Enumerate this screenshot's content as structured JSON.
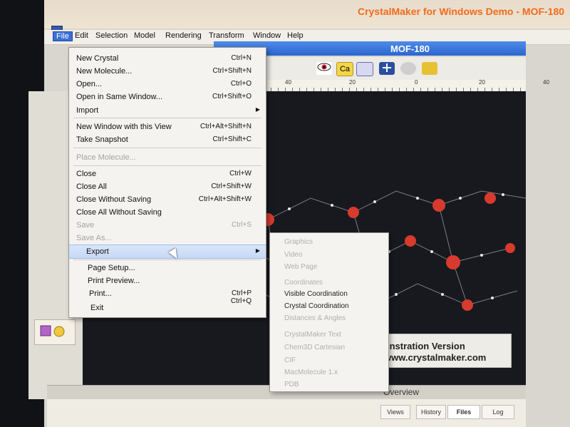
{
  "window": {
    "title": "CrystalMaker for Windows Demo - MOF-180"
  },
  "menubar": {
    "items": [
      "File",
      "Edit",
      "Selection",
      "Model",
      "Rendering",
      "Transform",
      "Window",
      "Help"
    ]
  },
  "document": {
    "title": "MOF-180"
  },
  "ruler": {
    "ticks": [
      "40",
      "20",
      "0",
      "20",
      "40"
    ]
  },
  "file_menu": {
    "items": [
      {
        "label": "New Crystal",
        "shortcut": "Ctrl+N"
      },
      {
        "label": "New Molecule...",
        "shortcut": "Ctrl+Shift+N"
      },
      {
        "label": "Open...",
        "shortcut": "Ctrl+O"
      },
      {
        "label": "Open in Same Window...",
        "shortcut": "Ctrl+Shift+O"
      },
      {
        "label": "Import",
        "shortcut": ""
      },
      {
        "label": "New Window with this View",
        "shortcut": "Ctrl+Alt+Shift+N"
      },
      {
        "label": "Take Snapshot",
        "shortcut": "Ctrl+Shift+C"
      },
      {
        "label": "Place Molecule...",
        "shortcut": ""
      },
      {
        "label": "Close",
        "shortcut": "Ctrl+W"
      },
      {
        "label": "Close All",
        "shortcut": "Ctrl+Shift+W"
      },
      {
        "label": "Close Without Saving",
        "shortcut": "Ctrl+Alt+Shift+W"
      },
      {
        "label": "Close All Without Saving",
        "shortcut": ""
      },
      {
        "label": "Save",
        "shortcut": "Ctrl+S"
      },
      {
        "label": "Save As...",
        "shortcut": ""
      },
      {
        "label": "Export",
        "shortcut": ""
      },
      {
        "label": "Page Setup...",
        "shortcut": ""
      },
      {
        "label": "Print Preview...",
        "shortcut": ""
      },
      {
        "label": "Print...",
        "shortcut": "Ctrl+P"
      },
      {
        "label": "Exit",
        "shortcut": "Ctrl+Q"
      }
    ]
  },
  "export_submenu": {
    "items": [
      "Graphics",
      "Video",
      "Web Page",
      "Coordinates",
      "Visible Coordination",
      "Crystal Coordination",
      "Distances & Angles",
      "CrystalMaker Text",
      "Chem3D Cartesian",
      "CIF",
      "MacMolecule 1.x",
      "PDB"
    ]
  },
  "watermark": {
    "line1": "er® Demonstration Version",
    "line2": "www.crystalmaker.com"
  },
  "overview": {
    "label": "Overview"
  },
  "tabs": [
    "Views",
    "History",
    "Files",
    "Log"
  ],
  "toolbar": {
    "ca_label": "Ca"
  }
}
